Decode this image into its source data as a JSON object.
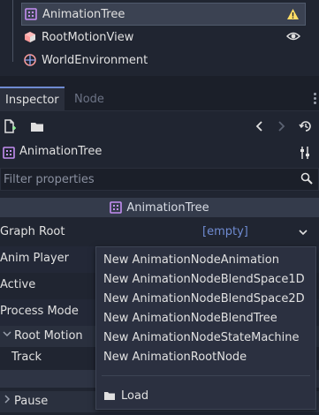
{
  "scene_tree": {
    "items": [
      {
        "label": "AnimationTree",
        "icon": "animation-tree-icon",
        "selected": true,
        "right_icon": "warning-icon"
      },
      {
        "label": "RootMotionView",
        "icon": "root-motion-view-icon",
        "selected": false,
        "right_icon": "eye-icon"
      },
      {
        "label": "WorldEnvironment",
        "icon": "world-environment-icon",
        "selected": false,
        "right_icon": ""
      }
    ]
  },
  "tabs": {
    "inspector": "Inspector",
    "node": "Node"
  },
  "inspector": {
    "object_name": "AnimationTree",
    "filter_placeholder": "Filter properties",
    "section_title": "AnimationTree",
    "properties": {
      "graph_root": "Graph Root",
      "graph_root_value": "[empty]",
      "anim_player": "Anim Player",
      "active": "Active",
      "process_mode": "Process Mode",
      "root_motion": "Root Motion",
      "track": "Track",
      "pause": "Pause"
    }
  },
  "popup_menu": {
    "items": [
      "New AnimationNodeAnimation",
      "New AnimationNodeBlendSpace1D",
      "New AnimationNodeBlendSpace2D",
      "New AnimationNodeBlendTree",
      "New AnimationNodeStateMachine",
      "New AnimationRootNode"
    ],
    "load": "Load"
  },
  "colors": {
    "background": "#202531",
    "accent": "#6f8bd1",
    "warning": "#ffdd65",
    "animation_tree_icon": "#c38ef1"
  }
}
